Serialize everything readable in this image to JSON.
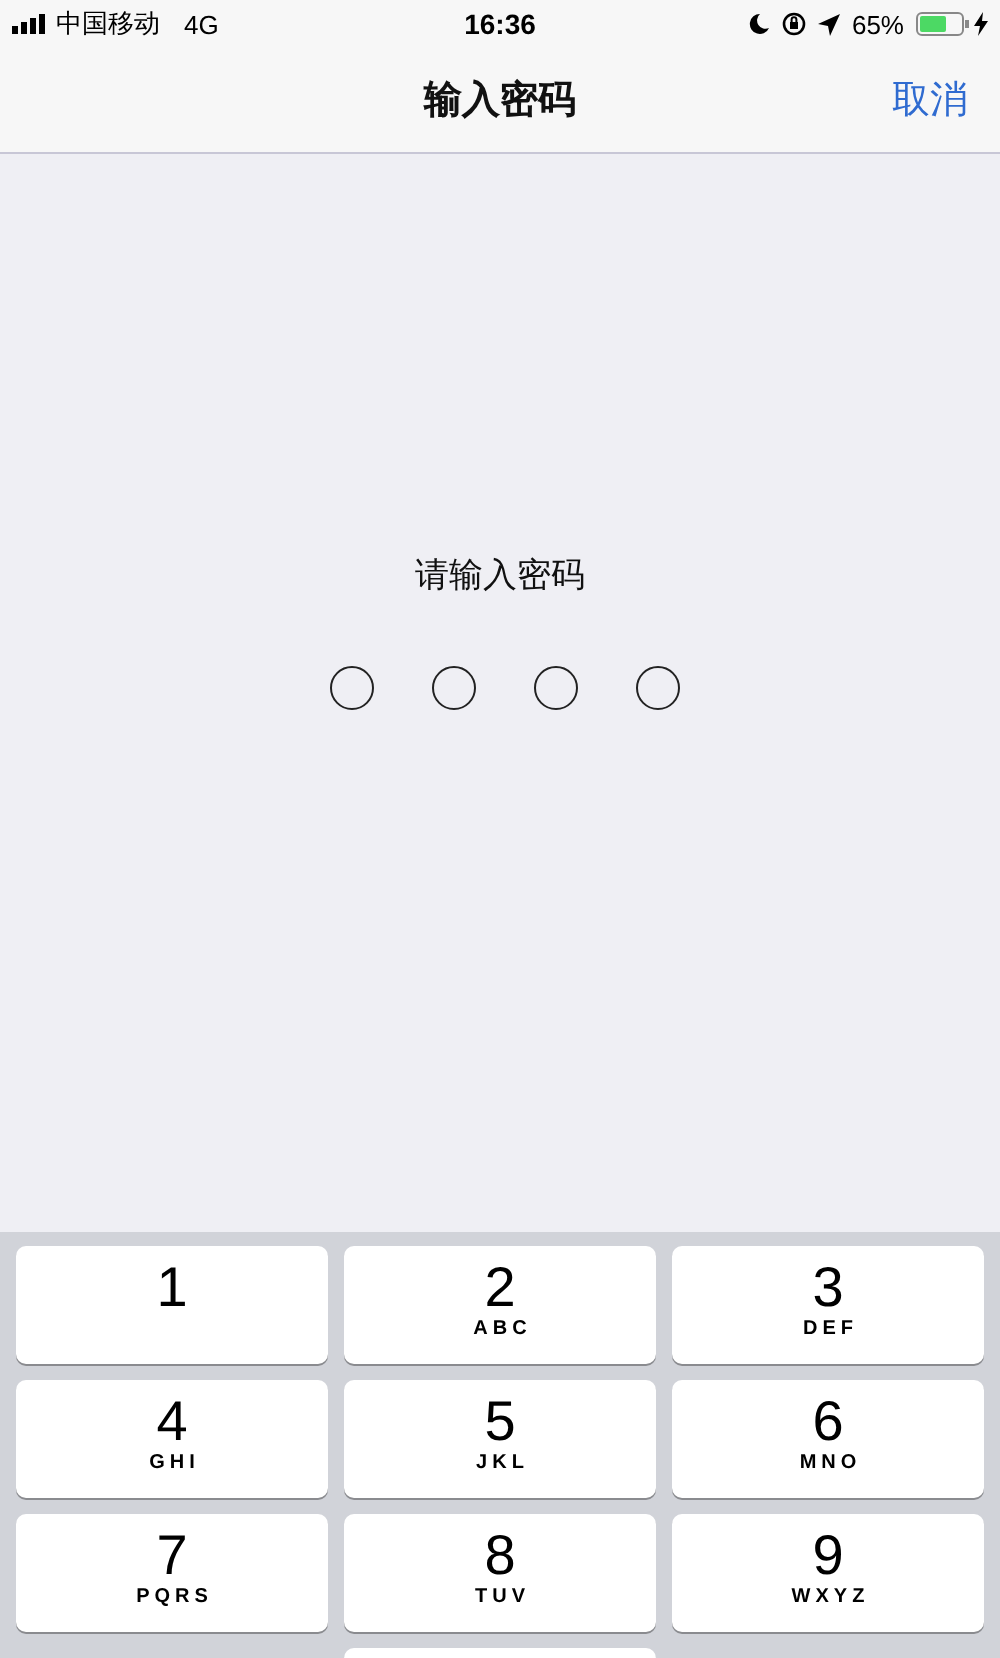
{
  "status_bar": {
    "carrier": "中国移动",
    "network": "4G",
    "time": "16:36",
    "battery": "65%"
  },
  "nav_bar": {
    "title": "输入密码",
    "cancel": "取消"
  },
  "passcode": {
    "prompt": "请输入密码",
    "digits": [
      {
        "filled": false
      },
      {
        "filled": false
      },
      {
        "filled": false
      },
      {
        "filled": false
      }
    ]
  },
  "keypad": {
    "keys": [
      {
        "kind": "digit",
        "number": "1"
      },
      {
        "kind": "digit",
        "number": "2",
        "letters": "ABC"
      },
      {
        "kind": "digit",
        "number": "3",
        "letters": "DEF"
      },
      {
        "kind": "digit",
        "number": "4",
        "letters": "GHI"
      },
      {
        "kind": "digit",
        "number": "5",
        "letters": "JKL"
      },
      {
        "kind": "digit",
        "number": "6",
        "letters": "MNO"
      },
      {
        "kind": "digit",
        "number": "7",
        "letters": "PQRS"
      },
      {
        "kind": "digit",
        "number": "8",
        "letters": "TUV"
      },
      {
        "kind": "digit",
        "number": "9",
        "letters": "WXYZ"
      },
      {
        "kind": "blank"
      },
      {
        "kind": "digit"
      },
      {
        "kind": "blank"
      }
    ]
  }
}
